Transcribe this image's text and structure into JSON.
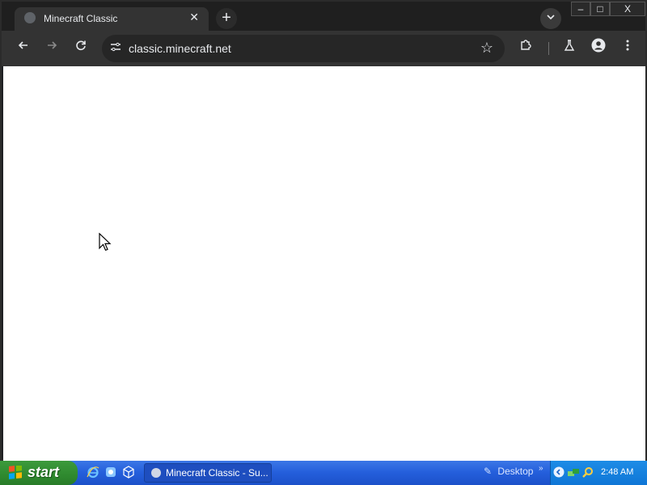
{
  "browser": {
    "tab_title": "Minecraft Classic",
    "url": "classic.minecraft.net",
    "window_controls": {
      "minimize": "–",
      "maximize": "□",
      "close": "X"
    }
  },
  "icons": {
    "back": "arrow-left-icon",
    "forward": "arrow-right-icon",
    "reload": "reload-icon",
    "site_info": "tune-icon",
    "bookmark": "star-icon",
    "extensions": "puzzle-icon",
    "labs": "flask-icon",
    "profile": "person-icon",
    "menu": "kebab-menu-icon"
  },
  "taskbar": {
    "start_label": "start",
    "window_button": "Minecraft Classic - Su...",
    "desktop_label": "Desktop",
    "clock": "2:48 AM"
  },
  "colors": {
    "chrome_dark": "#202124",
    "toolbar": "#333333",
    "taskbar_blue": "#245edb",
    "start_green": "#2f8a2f",
    "tray_blue": "#0f76d6"
  }
}
